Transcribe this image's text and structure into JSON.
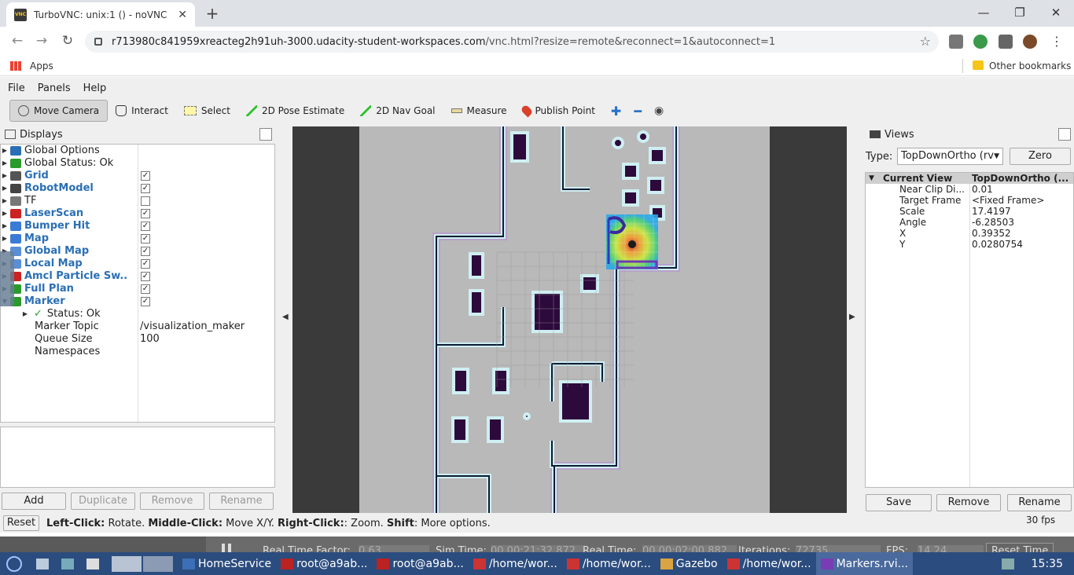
{
  "browser": {
    "tab_title": "TurboVNC: unix:1 () - noVNC",
    "favicon_text": "VNC",
    "url_host": "r713980c841959xreacteg2h91uh-3000.udacity-student-workspaces.com",
    "url_path": "/vnc.html?resize=remote&reconnect=1&autoconnect=1",
    "bookmarks": {
      "apps": "Apps",
      "other": "Other bookmarks"
    }
  },
  "rviz": {
    "menu": [
      "File",
      "Panels",
      "Help"
    ],
    "tools": [
      "Move Camera",
      "Interact",
      "Select",
      "2D Pose Estimate",
      "2D Nav Goal",
      "Measure",
      "Publish Point"
    ],
    "displays": {
      "title": "Displays",
      "items": [
        {
          "label": "Global Options",
          "style": "normal"
        },
        {
          "label": "Global Status: Ok",
          "style": "normal"
        },
        {
          "label": "Grid",
          "style": "blue",
          "checked": true
        },
        {
          "label": "RobotModel",
          "style": "blue",
          "checked": true
        },
        {
          "label": "TF",
          "style": "normal",
          "checked": false
        },
        {
          "label": "LaserScan",
          "style": "blue",
          "checked": true
        },
        {
          "label": "Bumper Hit",
          "style": "blue",
          "checked": true
        },
        {
          "label": "Map",
          "style": "blue",
          "checked": true
        },
        {
          "label": "Global Map",
          "style": "blue",
          "checked": true
        },
        {
          "label": "Local Map",
          "style": "blue",
          "checked": true
        },
        {
          "label": "Amcl Particle Sw...",
          "style": "blue",
          "checked": true
        },
        {
          "label": "Full Plan",
          "style": "blue",
          "checked": true
        },
        {
          "label": "Marker",
          "style": "blue",
          "checked": true
        }
      ],
      "marker_children": [
        {
          "label": "Status: Ok",
          "value": ""
        },
        {
          "label": "Marker Topic",
          "value": "/visualization_maker"
        },
        {
          "label": "Queue Size",
          "value": "100"
        },
        {
          "label": "Namespaces",
          "value": ""
        }
      ],
      "buttons": [
        "Add",
        "Duplicate",
        "Remove",
        "Rename"
      ]
    },
    "views": {
      "title": "Views",
      "type_label": "Type:",
      "type_value": "TopDownOrtho (rv",
      "zero_label": "Zero",
      "header": {
        "key": "Current View",
        "value": "TopDownOrtho (..."
      },
      "rows": [
        {
          "key": "Near Clip Di...",
          "value": "0.01"
        },
        {
          "key": "Target Frame",
          "value": "<Fixed Frame>"
        },
        {
          "key": "Scale",
          "value": "17.4197"
        },
        {
          "key": "Angle",
          "value": "-6.28503"
        },
        {
          "key": "X",
          "value": "0.39352"
        },
        {
          "key": "Y",
          "value": "0.0280754"
        }
      ],
      "buttons": [
        "Save",
        "Remove",
        "Rename"
      ]
    },
    "status": {
      "reset": "Reset",
      "b1": "Left-Click:",
      "t1": " Rotate. ",
      "b2": "Middle-Click:",
      "t2": " Move X/Y. ",
      "b3": "Right-Click:",
      "t3": ": Zoom. ",
      "b4": "Shift",
      "t4": ": More options.",
      "fps": "30 fps"
    }
  },
  "gazebo_bar": {
    "rtf_label": "Real Time Factor:",
    "rtf": "0.63",
    "sim_label": "Sim Time:",
    "sim": "00 00:21:32.872",
    "real_label": "Real Time:",
    "real": "00 00:02:00.882",
    "iter_label": "Iterations:",
    "iter": "72735",
    "fps_label": "FPS:",
    "fps": "14.24",
    "reset": "Reset Time"
  },
  "taskbar": {
    "items": [
      "HomeService",
      "root@a9ab...",
      "root@a9ab...",
      "/home/wor...",
      "/home/wor...",
      "Gazebo",
      "/home/wor...",
      "Markers.rvi..."
    ],
    "clock": "15:35"
  }
}
